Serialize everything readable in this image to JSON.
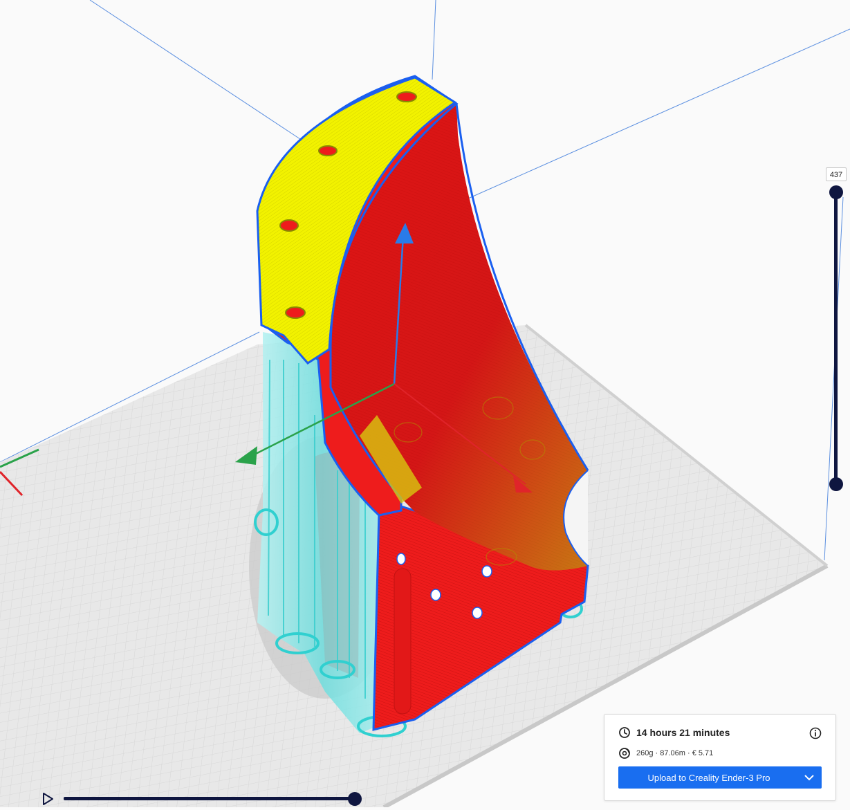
{
  "viewer": {
    "colors": {
      "background": "#fafafa",
      "build_plate": "#ececec",
      "grid_lines": "#d2d2d2",
      "wall_outer": "#ee1c1c",
      "top_skin": "#f2f200",
      "support": "#7fe6e6",
      "outline": "#1a5ff0",
      "axis_x": "#e0242a",
      "axis_y": "#2aa24a",
      "axis_z": "#2a7be8",
      "slider": "#0f1640"
    }
  },
  "layer_slider": {
    "current_layer": "437"
  },
  "print_info": {
    "time": "14 hours 21 minutes",
    "material": "260g · 87.06m · € 5.71",
    "upload_label": "Upload to Creality Ender-3 Pro",
    "accent": "#196ef0"
  },
  "icons": {
    "play": "play-icon",
    "clock": "clock-icon",
    "spool": "spool-icon",
    "info": "info-icon",
    "chevron": "chevron-down-icon"
  }
}
